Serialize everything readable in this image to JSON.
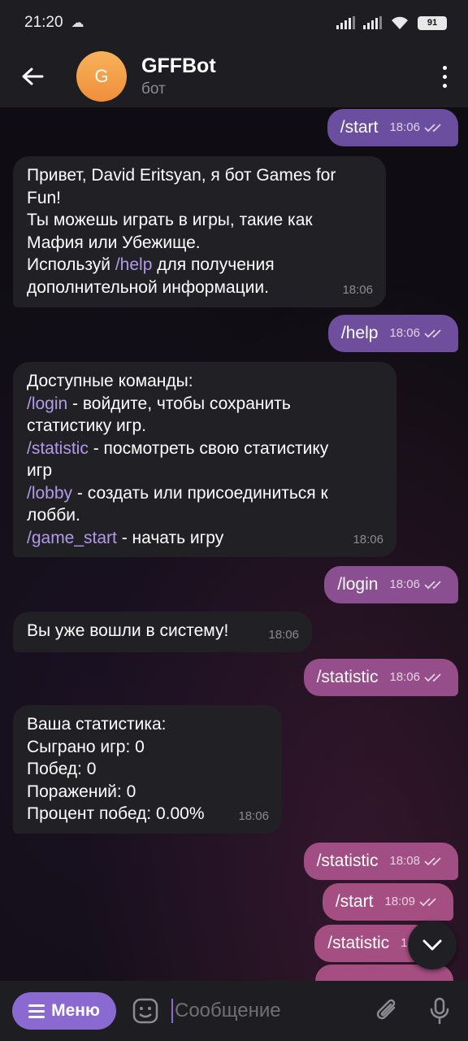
{
  "status_bar": {
    "time": "21:20",
    "battery": "91"
  },
  "header": {
    "avatar_letter": "G",
    "name": "GFFBot",
    "subtitle": "бот"
  },
  "colors": {
    "accent": "#8a6ad0",
    "outgoing_top": "#6b4ea0",
    "outgoing_bottom": "#a04e84",
    "incoming": "#212125",
    "command": "#b39ae8"
  },
  "messages": [
    {
      "dir": "out",
      "text": "/start",
      "time": "18:06"
    },
    {
      "dir": "in",
      "lines": [
        "Привет, David Eritsyan, я бот Games for",
        "Fun!",
        "Ты можешь играть в игры, такие как",
        "Мафия или Убежище."
      ],
      "cmd_prefix": "Используй ",
      "cmd": "/help",
      "cmd_suffix": " для получения",
      "last_line": "дополнительной информации.",
      "time": "18:06"
    },
    {
      "dir": "out",
      "text": "/help",
      "time": "18:06"
    },
    {
      "dir": "in",
      "head": "Доступные команды:",
      "items": [
        {
          "cmd": "/login",
          "desc": " - войдите, чтобы сохранить",
          "cont": "статистику игр."
        },
        {
          "cmd": "/statistic",
          "desc": " - посмотреть свою статистику",
          "cont": "игр"
        },
        {
          "cmd": "/lobby",
          "desc": " - создать или присоединиться к",
          "cont": "лобби."
        },
        {
          "cmd": "/game_start",
          "desc": " - начать игру",
          "cont": ""
        }
      ],
      "time": "18:06"
    },
    {
      "dir": "out",
      "text": "/login",
      "time": "18:06"
    },
    {
      "dir": "in",
      "text": "Вы уже вошли в систему!",
      "time": "18:06"
    },
    {
      "dir": "out",
      "text": "/statistic",
      "time": "18:06"
    },
    {
      "dir": "in",
      "lines": [
        "Ваша статистика:",
        "Сыграно игр: 0",
        "Побед: 0",
        "Поражений: 0",
        "Процент побед: 0.00%"
      ],
      "time": "18:06"
    },
    {
      "dir": "out",
      "text": "/statistic",
      "time": "18:08"
    },
    {
      "dir": "out",
      "text": "/start",
      "time": "18:09"
    },
    {
      "dir": "out",
      "text": "/statistic",
      "time": "18:"
    }
  ],
  "composer": {
    "menu_label": "Меню",
    "placeholder": "Сообщение"
  }
}
